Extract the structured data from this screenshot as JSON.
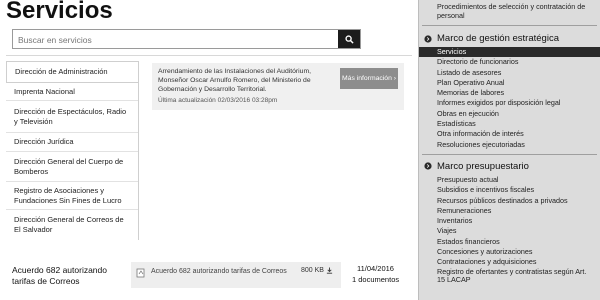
{
  "page": {
    "title": "Servicios"
  },
  "search": {
    "placeholder": "Buscar en servicios"
  },
  "subnav": {
    "items": [
      "Dirección de Administración",
      "Imprenta Nacional",
      "Dirección de Espectáculos, Radio y Televisión",
      "Dirección Jurídica",
      "Dirección General del Cuerpo de Bomberos",
      "Registro de Asociaciones y Fundaciones Sin Fines de Lucro",
      "Dirección General de Correos de El Salvador"
    ]
  },
  "card": {
    "text": "Arrendamiento de las Instalaciones del Auditórium, Monseñor Oscar Arnulfo Romero, del Ministerio de Gobernación y Desarrollo Territorial.",
    "updated": "Última actualización 02/03/2016 03:28pm",
    "button": "Más información ›"
  },
  "footer_row": {
    "title": "Acuerdo 682 autorizando tarifas de Correos",
    "doc_name": "Acuerdo 682 autorizando tarifas de Correos",
    "doc_size": "800 KB",
    "date": "11/04/2016",
    "count": "1 documentos"
  },
  "sidebar": {
    "top_link": "Procedimientos de selección y contratación de personal",
    "sections": [
      {
        "heading": "Marco de gestión estratégica",
        "links": [
          "Servicios",
          "Directorio de funcionarios",
          "Listado de asesores",
          "Plan Operativo Anual",
          "Memorias de labores",
          "Informes exigidos por disposición legal",
          "Obras en ejecución",
          "Estadísticas",
          "Otra información de interés",
          "Resoluciones ejecutoriadas"
        ],
        "active": "Servicios"
      },
      {
        "heading": "Marco presupuestario",
        "links": [
          "Presupuesto actual",
          "Subsidios e incentivos fiscales",
          "Recursos públicos destinados a privados",
          "Remuneraciones",
          "Inventarios",
          "Viajes",
          "Estados financieros",
          "Concesiones y autorizaciones",
          "Contrataciones y adquisiciones",
          "Registro de ofertantes y contratistas según Art. 15 LACAP"
        ]
      }
    ]
  },
  "colors": {
    "sidebar_bg": "#dcdcdc",
    "active_bg": "#2a2a2a",
    "button_bg": "#8d8d8d",
    "card_bg": "#f0f0f0"
  }
}
